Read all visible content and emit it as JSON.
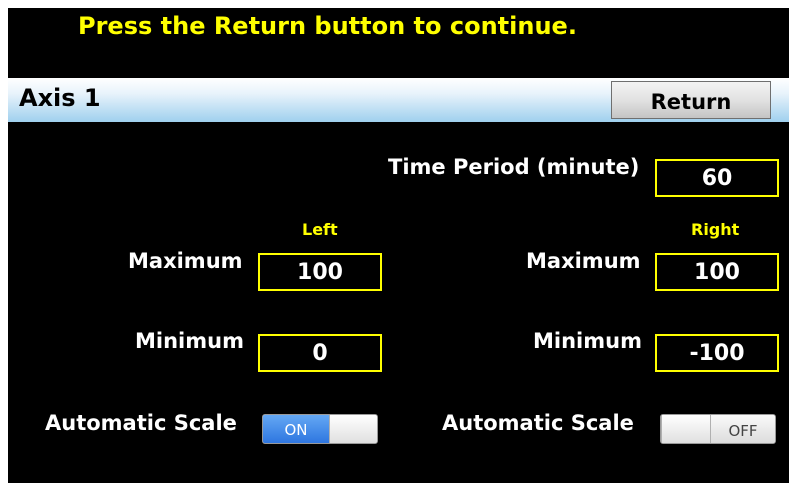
{
  "prompt": "Press the Return button to continue.",
  "header": {
    "title": "Axis 1",
    "return_label": "Return"
  },
  "time_period": {
    "label": "Time Period (minute)",
    "value": "60"
  },
  "left": {
    "heading": "Left",
    "maximum_label": "Maximum",
    "maximum": "100",
    "minimum_label": "Minimum",
    "minimum": "0",
    "auto_scale_label": "Automatic Scale",
    "auto_scale_state": "ON"
  },
  "right": {
    "heading": "Right",
    "maximum_label": "Maximum",
    "maximum": "100",
    "minimum_label": "Minimum",
    "minimum": "-100",
    "auto_scale_label": "Automatic Scale",
    "auto_scale_state": "OFF"
  },
  "colors": {
    "prompt": "#ffff00",
    "field_border": "#ffff00",
    "toggle_on": "#2e76e0"
  }
}
